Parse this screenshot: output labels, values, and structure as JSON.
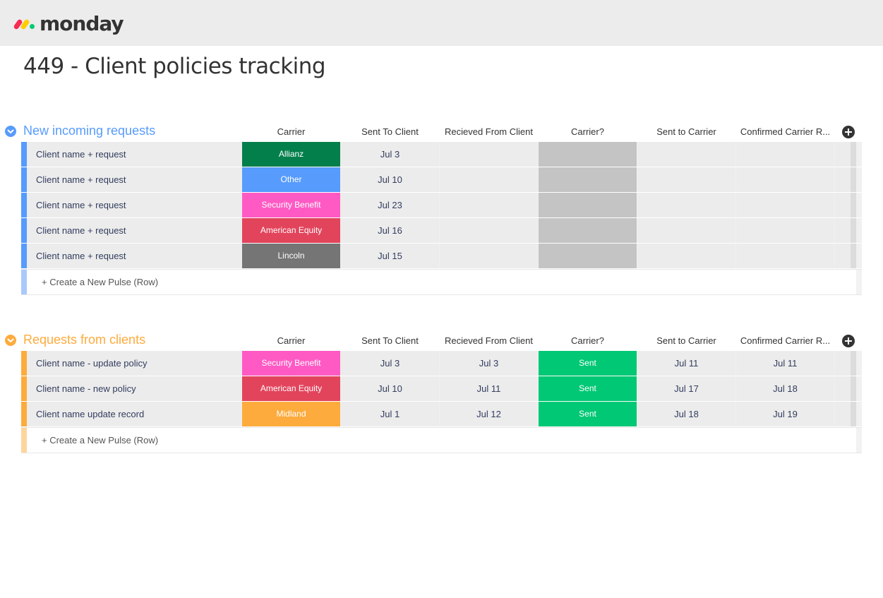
{
  "app": {
    "logo_text": "monday"
  },
  "board": {
    "title": "449 - Client policies tracking"
  },
  "colors": {
    "blue_group": "#579bfc",
    "orange_group": "#fdab3d",
    "status_grey": "#c4c4c4"
  },
  "groups": [
    {
      "title": "New incoming requests",
      "color": "#579bfc",
      "stripe_light": "#a9c9fd",
      "columns": [
        "Carrier",
        "Sent To Client",
        "Recieved From Client",
        "Carrier?",
        "Sent to Carrier",
        "Confirmed Carrier R..."
      ],
      "rows": [
        {
          "name": "Client name + request",
          "carrier": "Allianz",
          "carrier_color": "#037f4c",
          "sent_to_client": "Jul 3",
          "received": "",
          "carrier_q": "",
          "carrier_q_color": "#c4c4c4",
          "sent_to_carrier": "",
          "confirmed": ""
        },
        {
          "name": "Client name + request",
          "carrier": "Other",
          "carrier_color": "#579bfc",
          "sent_to_client": "Jul 10",
          "received": "",
          "carrier_q": "",
          "carrier_q_color": "#c4c4c4",
          "sent_to_carrier": "",
          "confirmed": ""
        },
        {
          "name": "Client name + request",
          "carrier": "Security Benefit",
          "carrier_color": "#ff5ac4",
          "sent_to_client": "Jul 23",
          "received": "",
          "carrier_q": "",
          "carrier_q_color": "#c4c4c4",
          "sent_to_carrier": "",
          "confirmed": ""
        },
        {
          "name": "Client name + request",
          "carrier": "American Equity",
          "carrier_color": "#e2445c",
          "sent_to_client": "Jul 16",
          "received": "",
          "carrier_q": "",
          "carrier_q_color": "#c4c4c4",
          "sent_to_carrier": "",
          "confirmed": ""
        },
        {
          "name": "Client name + request",
          "carrier": "Lincoln",
          "carrier_color": "#757575",
          "sent_to_client": "Jul 15",
          "received": "",
          "carrier_q": "",
          "carrier_q_color": "#c4c4c4",
          "sent_to_carrier": "",
          "confirmed": ""
        }
      ],
      "create_label": "+ Create a New Pulse (Row)"
    },
    {
      "title": "Requests from clients",
      "color": "#fdab3d",
      "stripe_light": "#fdd59e",
      "columns": [
        "Carrier",
        "Sent To Client",
        "Recieved From Client",
        "Carrier?",
        "Sent to Carrier",
        "Confirmed Carrier R..."
      ],
      "rows": [
        {
          "name": "Client name - update policy",
          "carrier": "Security Benefit",
          "carrier_color": "#ff5ac4",
          "sent_to_client": "Jul 3",
          "received": "Jul 3",
          "carrier_q": "Sent",
          "carrier_q_color": "#00c875",
          "sent_to_carrier": "Jul 11",
          "confirmed": "Jul 11"
        },
        {
          "name": "Client name - new policy",
          "carrier": "American Equity",
          "carrier_color": "#e2445c",
          "sent_to_client": "Jul 10",
          "received": "Jul 11",
          "carrier_q": "Sent",
          "carrier_q_color": "#00c875",
          "sent_to_carrier": "Jul 17",
          "confirmed": "Jul 18"
        },
        {
          "name": "Client name update record",
          "carrier": "Midland",
          "carrier_color": "#fdab3d",
          "sent_to_client": "Jul 1",
          "received": "Jul 12",
          "carrier_q": "Sent",
          "carrier_q_color": "#00c875",
          "sent_to_carrier": "Jul 18",
          "confirmed": "Jul 19"
        }
      ],
      "create_label": "+ Create a New Pulse (Row)"
    }
  ],
  "icons": {
    "collapse": "chevron-down-icon",
    "add_column": "plus-circle-icon"
  }
}
